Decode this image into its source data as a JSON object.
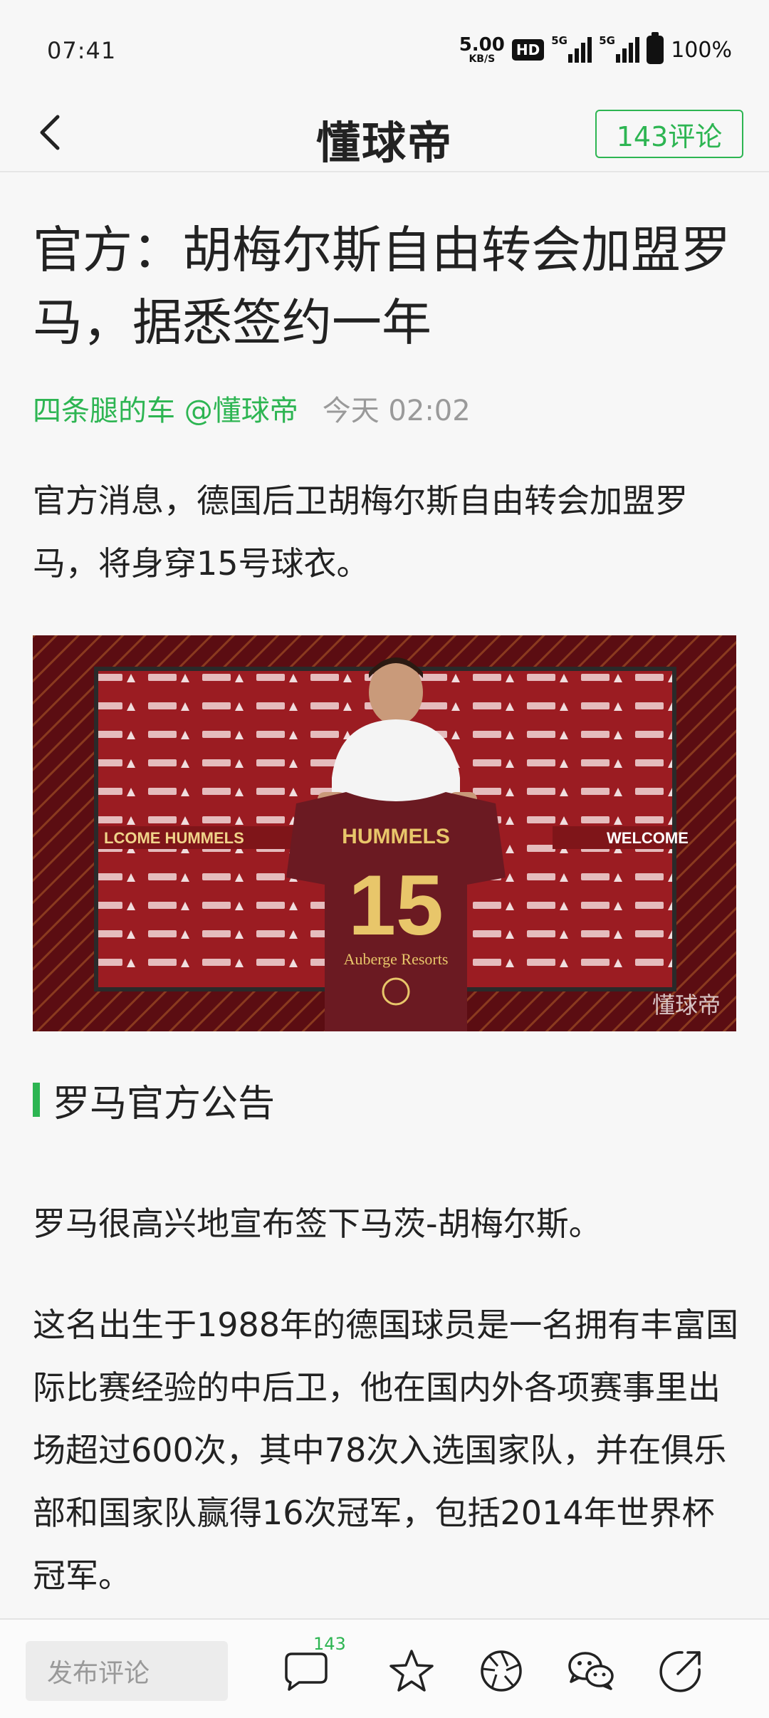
{
  "status_bar": {
    "time": "07:41",
    "net_speed_value": "5.00",
    "net_speed_unit": "KB/S",
    "hd_label": "HD",
    "signal1_tag": "5G",
    "signal2_tag": "5G",
    "battery_percent": "100%"
  },
  "header": {
    "logo_text": "懂球帝",
    "comment_button_label": "143评论"
  },
  "article": {
    "title": "官方：胡梅尔斯自由转会加盟罗马，据悉签约一年",
    "author": "四条腿的车 @懂球帝",
    "time_label": "今天 02:02",
    "intro": "官方消息，德国后卫胡梅尔斯自由转会加盟罗马，将身穿15号球衣。",
    "image": {
      "welcome_left": "LCOME HUMMELS",
      "welcome_right": "WELCOME",
      "jersey_name": "HUMMELS",
      "jersey_number": "15",
      "jersey_sponsor": "Auberge Resorts",
      "watermark": "懂球帝"
    },
    "section_heading": "罗马官方公告",
    "paragraph_2": "罗马很高兴地宣布签下马茨-胡梅尔斯。",
    "paragraph_3": "这名出生于1988年的德国球员是一名拥有丰富国际比赛经验的中后卫，他在国内外各项赛事里出场超过600次，其中78次入选国家队，并在俱乐部和国家队赢得16次冠军，包括2014年世界杯冠军。"
  },
  "bottom_bar": {
    "comment_placeholder": "发布评论",
    "comment_count": "143"
  },
  "colors": {
    "accent": "#2db552",
    "backdrop": "#8e1a1f",
    "jersey": "#6b1a22",
    "jersey_text": "#e8c66a"
  }
}
